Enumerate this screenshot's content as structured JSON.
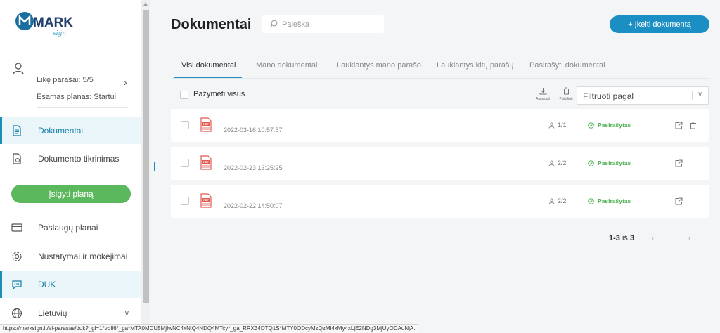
{
  "sidebar": {
    "logo_text": "MARK",
    "logo_sub": "sign",
    "user": {
      "signatures_left": "Likę parašai: 5/5",
      "current_plan": "Esamas planas: Startui"
    },
    "items": [
      {
        "label": "Dokumentai"
      },
      {
        "label": "Dokumento tikrinimas"
      },
      {
        "label": "Paslaugų planai"
      },
      {
        "label": "Nustatymai ir mokėjimai"
      },
      {
        "label": "DUK"
      },
      {
        "label": "Lietuvių"
      }
    ],
    "buy_button": "Įsigyti planą"
  },
  "header": {
    "title": "Dokumentai",
    "search_placeholder": "Paieška",
    "upload_button": "+ Įkelti dokumentą"
  },
  "tabs": [
    {
      "label": "Visi dokumentai"
    },
    {
      "label": "Mano dokumentai"
    },
    {
      "label": "Laukiantys mano parašo"
    },
    {
      "label": "Laukiantys kitų parašų"
    },
    {
      "label": "Pasirašyti dokumentai"
    }
  ],
  "toolbar": {
    "select_all": "Pažymėti visus",
    "download_label": "Atsisiųsti",
    "delete_label": "Pašalinti",
    "filter_placeholder": "Filtruoti pagal"
  },
  "documents": [
    {
      "date": "2022-03-16 10:57:57",
      "signers": "1/1",
      "status": "Pasirašytas"
    },
    {
      "date": "2022-02-23 13:25:25",
      "signers": "2/2",
      "status": "Pasirašytas"
    },
    {
      "date": "2022-02-22 14:50:07",
      "signers": "2/2",
      "status": "Pasirašytas"
    }
  ],
  "pagination": {
    "range": "1-3",
    "of": "iš",
    "total": "3"
  },
  "colors": {
    "accent": "#1b8fc4",
    "success": "#4caf50",
    "buy": "#5cb85c",
    "pdf": "#e05a4f"
  },
  "status_url": "https://marksign.lt/el-parasas/duk?_gl=1*vbfl6*_ga*MTA0MDU5MjIwNC4xNjQ4NDQ4MTcy*_ga_RRX34DTQ1S*MTY0ODcyMzQzMi4xMy4xLjE2NDg3MjUyODAuNjA."
}
